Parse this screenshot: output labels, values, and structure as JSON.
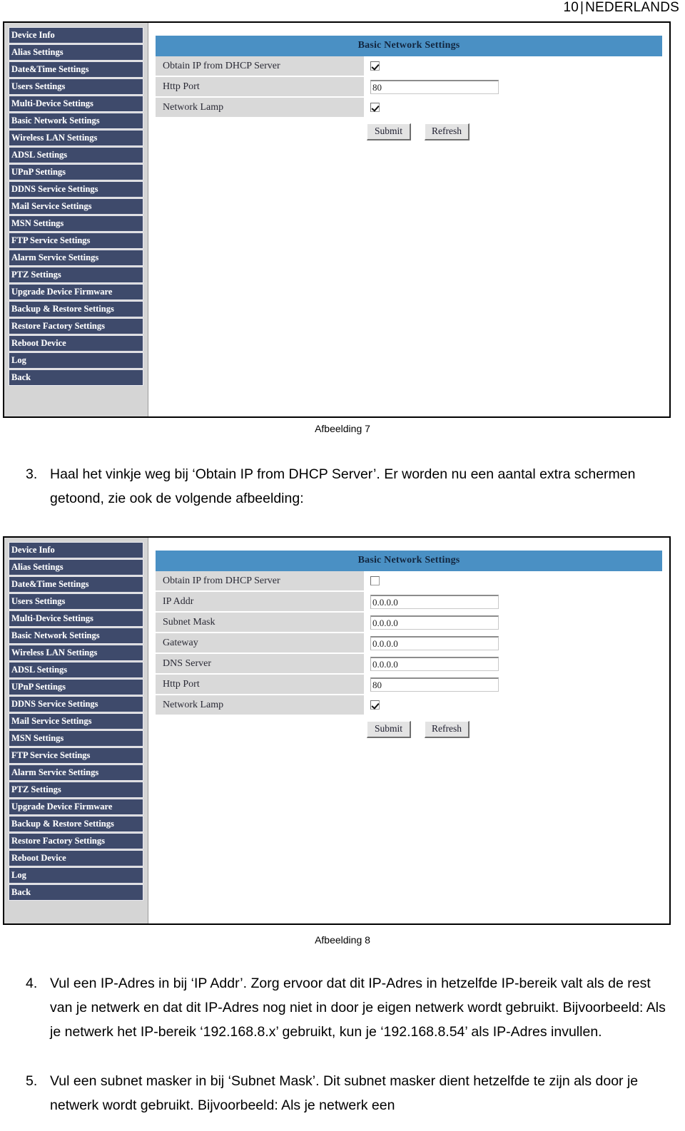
{
  "header": {
    "page_number": "10",
    "separator": "|",
    "section": "NEDERLANDS"
  },
  "sidebar_menu": [
    "Device Info",
    "Alias Settings",
    "Date&Time Settings",
    "Users Settings",
    "Multi-Device Settings",
    "Basic Network Settings",
    "Wireless LAN Settings",
    "ADSL Settings",
    "UPnP Settings",
    "DDNS Service Settings",
    "Mail Service Settings",
    "MSN Settings",
    "FTP Service Settings",
    "Alarm Service Settings",
    "PTZ Settings",
    "Upgrade Device Firmware",
    "Backup & Restore Settings",
    "Restore Factory Settings",
    "Reboot Device",
    "Log",
    "Back"
  ],
  "figure7": {
    "caption": "Afbeelding 7",
    "panel_title": "Basic Network Settings",
    "rows": [
      {
        "label": "Obtain IP from DHCP Server",
        "type": "checkbox",
        "checked": true
      },
      {
        "label": "Http Port",
        "type": "text",
        "value": "80"
      },
      {
        "label": "Network Lamp",
        "type": "checkbox",
        "checked": true
      }
    ],
    "submit_label": "Submit",
    "refresh_label": "Refresh"
  },
  "figure8": {
    "caption": "Afbeelding 8",
    "panel_title": "Basic Network Settings",
    "rows": [
      {
        "label": "Obtain IP from DHCP Server",
        "type": "checkbox",
        "checked": false
      },
      {
        "label": "IP Addr",
        "type": "text",
        "value": "0.0.0.0"
      },
      {
        "label": "Subnet Mask",
        "type": "text",
        "value": "0.0.0.0"
      },
      {
        "label": "Gateway",
        "type": "text",
        "value": "0.0.0.0"
      },
      {
        "label": "DNS Server",
        "type": "text",
        "value": "0.0.0.0"
      },
      {
        "label": "Http Port",
        "type": "text",
        "value": "80"
      },
      {
        "label": "Network Lamp",
        "type": "checkbox",
        "checked": true
      }
    ],
    "submit_label": "Submit",
    "refresh_label": "Refresh"
  },
  "steps": [
    {
      "number": "3.",
      "text": "Haal het vinkje weg bij ‘Obtain IP from DHCP Server’. Er worden nu een aantal extra schermen getoond, zie ook de volgende afbeelding:"
    },
    {
      "number": "4.",
      "text": "Vul een IP-Adres in bij ‘IP Addr’. Zorg ervoor dat dit IP-Adres in hetzelfde IP-bereik valt als de rest van je netwerk en dat dit IP-Adres nog niet in door je eigen netwerk wordt gebruikt. Bijvoorbeeld: Als je netwerk het IP-bereik ‘192.168.8.x’ gebruikt, kun je ‘192.168.8.54’ als IP-Adres invullen."
    },
    {
      "number": "5.",
      "text": "Vul een subnet masker in bij ‘Subnet Mask’. Dit subnet masker dient hetzelfde te zijn als door je netwerk wordt gebruikt. Bijvoorbeeld: Als je netwerk een"
    }
  ],
  "colors": {
    "sidebar_item": "#3e4a6b",
    "panel_title_bg": "#4a90c4",
    "row_label_bg": "#d9d9d9",
    "sidebar_bg": "#d5d5d5"
  }
}
